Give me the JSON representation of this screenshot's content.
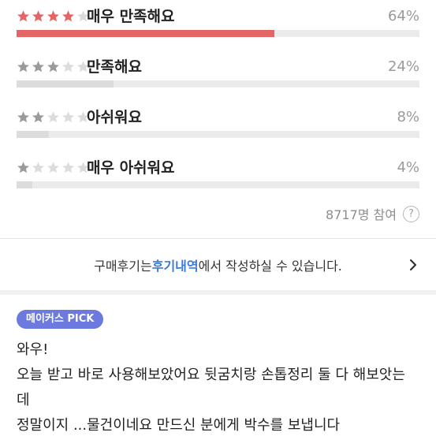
{
  "ratings": [
    {
      "label": "매우 만족해요",
      "percent": "64%",
      "stars": 4,
      "fill": 0.64,
      "highlight": true
    },
    {
      "label": "만족해요",
      "percent": "24%",
      "stars": 3,
      "fill": 0.24,
      "highlight": false
    },
    {
      "label": "아쉬워요",
      "percent": "8%",
      "stars": 2,
      "fill": 0.08,
      "highlight": false
    },
    {
      "label": "매우 아쉬워요",
      "percent": "4%",
      "stars": 1,
      "fill": 0.04,
      "highlight": false
    }
  ],
  "participants": {
    "text": "8717명 참여",
    "help_glyph": "?"
  },
  "notice": {
    "prefix": "구매후기는 ",
    "link": "후기내역",
    "suffix": "에서 작성하실 수 있습니다."
  },
  "review": {
    "badge": "메이커스 PICK",
    "lines": [
      "와우!",
      "오늘 받고 바로 사용해보았어요 뒷굼치랑 손톱정리 둘 다 해보앗는",
      "데",
      "정말이지 ...물건이네요 만드신 분에게 박수를 보냅니다"
    ]
  },
  "colors": {
    "star_active_top": "#e36565",
    "star_active": "#9a9a9a",
    "star_inactive": "#dcdcdc",
    "accent": "#3a7bd5",
    "badge": "#6c7ae0"
  },
  "icons": {
    "star": "star-icon",
    "help": "help-circle-icon",
    "chevron": "chevron-right-icon"
  }
}
